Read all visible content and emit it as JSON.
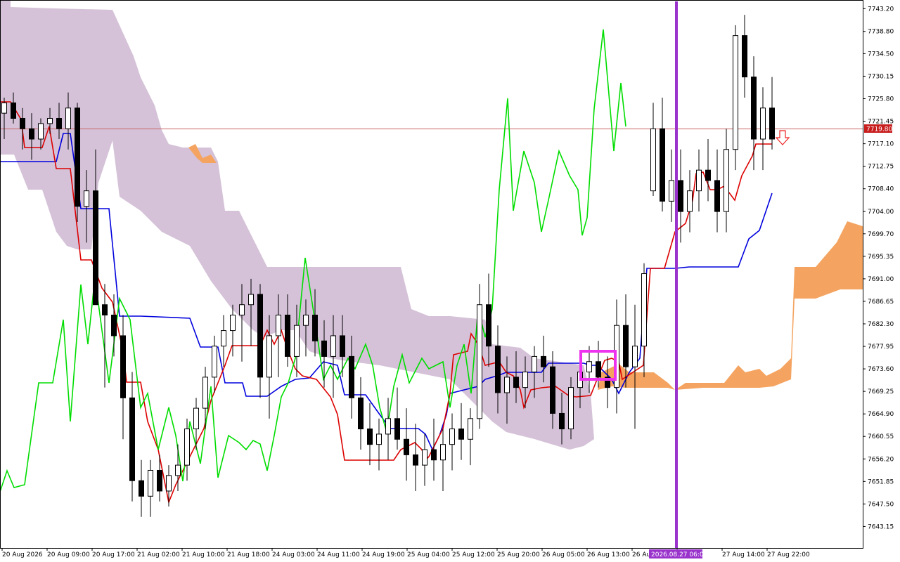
{
  "chart_data": {
    "type": "candlestick",
    "y_ticks": [
      7743.2,
      7738.8,
      7734.5,
      7730.15,
      7725.8,
      7721.45,
      7717.1,
      7712.75,
      7708.4,
      7704.0,
      7699.7,
      7695.35,
      7691.0,
      7686.65,
      7682.3,
      7677.95,
      7673.6,
      7669.25,
      7664.9,
      7660.55,
      7656.2,
      7651.85,
      7647.5,
      7643.15
    ],
    "y_tick_labels": [
      "7743.20",
      "7738.80",
      "7734.50",
      "7730.15",
      "7725.80",
      "7721.45",
      "7717.10",
      "7712.75",
      "7708.40",
      "7704.00",
      "7699.70",
      "7695.35",
      "7691.00",
      "7686.65",
      "7682.30",
      "7677.95",
      "7673.60",
      "7669.25",
      "7664.90",
      "7660.55",
      "7656.20",
      "7651.85",
      "7647.50",
      "7643.15"
    ],
    "ylim": [
      7639.0,
      7744.6
    ],
    "x_tick_labels": [
      "20 Aug 2026",
      "20 Aug 09:00",
      "20 Aug 17:00",
      "21 Aug 02:00",
      "21 Aug 10:00",
      "21 Aug 18:00",
      "24 Aug 03:00",
      "24 Aug 11:00",
      "24 Aug 19:00",
      "25 Aug 04:00",
      "25 Aug 12:00",
      "25 Aug 20:00",
      "26 Aug 05:00",
      "26 Aug 13:00",
      "26 Au",
      "",
      "27 Aug 14:00",
      "27 Aug 22:00"
    ],
    "current_price": 7719.8,
    "current_price_label": "7719.80",
    "vertical_line_label": "2026.08.27 06:00",
    "candles": [
      [
        7723,
        7726,
        7718,
        7725
      ],
      [
        7725,
        7727,
        7721,
        7722
      ],
      [
        7722,
        7724,
        7716,
        7720
      ],
      [
        7720,
        7723,
        7714,
        7718
      ],
      [
        7718,
        7722,
        7716,
        7721
      ],
      [
        7721,
        7724,
        7719,
        7722
      ],
      [
        7722,
        7725,
        7718,
        7720
      ],
      [
        7720,
        7727,
        7716,
        7724
      ],
      [
        7724,
        7725,
        7702,
        7705
      ],
      [
        7705,
        7712,
        7698,
        7708
      ],
      [
        7708,
        7716,
        7690,
        7686
      ],
      [
        7686,
        7690,
        7670,
        7684
      ],
      [
        7684,
        7688,
        7676,
        7680
      ],
      [
        7680,
        7684,
        7660,
        7668
      ],
      [
        7668,
        7673,
        7648,
        7652
      ],
      [
        7652,
        7656,
        7645,
        7649
      ],
      [
        7649,
        7656,
        7645,
        7654
      ],
      [
        7654,
        7657,
        7648,
        7650
      ],
      [
        7650,
        7655,
        7647,
        7653
      ],
      [
        7653,
        7659,
        7650,
        7655
      ],
      [
        7655,
        7664,
        7652,
        7662
      ],
      [
        7662,
        7668,
        7658,
        7666
      ],
      [
        7666,
        7674,
        7662,
        7672
      ],
      [
        7672,
        7680,
        7669,
        7678
      ],
      [
        7678,
        7684,
        7674,
        7681
      ],
      [
        7681,
        7686,
        7676,
        7684
      ],
      [
        7684,
        7690,
        7675,
        7686
      ],
      [
        7686,
        7691,
        7678,
        7688
      ],
      [
        7688,
        7690,
        7668,
        7672
      ],
      [
        7672,
        7684,
        7664,
        7680
      ],
      [
        7680,
        7688,
        7672,
        7684
      ],
      [
        7684,
        7688,
        7674,
        7676
      ],
      [
        7676,
        7686,
        7672,
        7682
      ],
      [
        7682,
        7687,
        7676,
        7684
      ],
      [
        7684,
        7689,
        7676,
        7679
      ],
      [
        7679,
        7683,
        7670,
        7676
      ],
      [
        7676,
        7684,
        7668,
        7680
      ],
      [
        7680,
        7684,
        7672,
        7676
      ],
      [
        7676,
        7680,
        7664,
        7668
      ],
      [
        7668,
        7672,
        7658,
        7662
      ],
      [
        7662,
        7667,
        7655,
        7659
      ],
      [
        7659,
        7664,
        7654,
        7661
      ],
      [
        7661,
        7668,
        7656,
        7664
      ],
      [
        7664,
        7670,
        7658,
        7660
      ],
      [
        7660,
        7666,
        7652,
        7657
      ],
      [
        7657,
        7663,
        7650,
        7655
      ],
      [
        7655,
        7661,
        7651,
        7658
      ],
      [
        7658,
        7664,
        7652,
        7656
      ],
      [
        7656,
        7662,
        7650,
        7659
      ],
      [
        7659,
        7665,
        7654,
        7662
      ],
      [
        7662,
        7667,
        7656,
        7660
      ],
      [
        7660,
        7666,
        7655,
        7664
      ],
      [
        7664,
        7690,
        7662,
        7686
      ],
      [
        7686,
        7692,
        7674,
        7678
      ],
      [
        7678,
        7682,
        7665,
        7669
      ],
      [
        7669,
        7676,
        7663,
        7672
      ],
      [
        7672,
        7677,
        7667,
        7670
      ],
      [
        7670,
        7676,
        7666,
        7673
      ],
      [
        7673,
        7678,
        7668,
        7676
      ],
      [
        7676,
        7680,
        7671,
        7674
      ],
      [
        7674,
        7677,
        7662,
        7665
      ],
      [
        7665,
        7669,
        7659,
        7662
      ],
      [
        7662,
        7672,
        7660,
        7670
      ],
      [
        7670,
        7676,
        7666,
        7673
      ],
      [
        7673,
        7678,
        7669,
        7675
      ],
      [
        7675,
        7679,
        7670,
        7672
      ],
      [
        7672,
        7676,
        7666,
        7670
      ],
      [
        7670,
        7687,
        7665,
        7682
      ],
      [
        7682,
        7688,
        7670,
        7674
      ],
      [
        7674,
        7686,
        7662,
        7678
      ],
      [
        7678,
        7694,
        7672,
        7692
      ],
      [
        7708,
        7725,
        7707,
        7720
      ],
      [
        7720,
        7726,
        7704,
        7706
      ],
      [
        7706,
        7716,
        7702,
        7710
      ],
      [
        7710,
        7716,
        7698,
        7704
      ],
      [
        7704,
        7712,
        7700,
        7708
      ],
      [
        7708,
        7716,
        7704,
        7712
      ],
      [
        7712,
        7718,
        7706,
        7710
      ],
      [
        7710,
        7716,
        7700,
        7704
      ],
      [
        7704,
        7720,
        7700,
        7716
      ],
      [
        7716,
        7740,
        7712,
        7738
      ],
      [
        7738,
        7742,
        7726,
        7730
      ],
      [
        7730,
        7734,
        7712,
        7718
      ],
      [
        7718,
        7728,
        7712,
        7724
      ],
      [
        7724,
        7730,
        7716,
        7718
      ]
    ]
  }
}
